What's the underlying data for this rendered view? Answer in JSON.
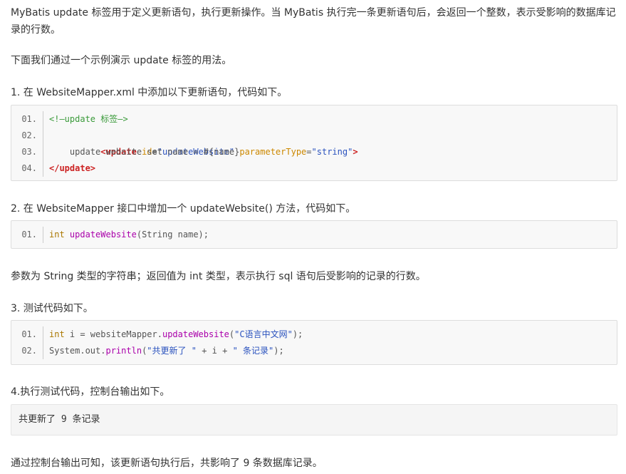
{
  "intro": {
    "para1": "MyBatis update 标签用于定义更新语句，执行更新操作。当 MyBatis 执行完一条更新语句后，会返回一个整数，表示受影响的数据库记录的行数。",
    "para2": "下面我们通过一个示例演示 update 标签的用法。"
  },
  "steps": [
    {
      "heading": "1. 在 WebsiteMapper.xml 中添加以下更新语句，代码如下。"
    },
    {
      "heading": "2. 在 WebsiteMapper 接口中增加一个 updateWebsite() 方法，代码如下。"
    },
    {
      "heading": "3. 测试代码如下。"
    },
    {
      "heading": "4.执行测试代码，控制台输出如下。"
    }
  ],
  "code_block_1": {
    "lines": [
      {
        "num": "01.",
        "comment": "<!—update 标签—>"
      },
      {
        "num": "02.",
        "tag_open": "<update",
        "attr1": "id",
        "eq1": "=",
        "val1": "\"updateWebsite\"",
        "attr2": "parameterType",
        "eq2": "=",
        "val2": "\"string\"",
        "tag_close": ">"
      },
      {
        "num": "03.",
        "text": "    update website set name = #{name}"
      },
      {
        "num": "04.",
        "tag_end": "</update>"
      }
    ]
  },
  "code_block_2": {
    "lines": [
      {
        "num": "01.",
        "kw": "int",
        "fn": "updateWebsite",
        "rest": "(String name);"
      }
    ]
  },
  "code_block_3": {
    "lines": [
      {
        "num": "01.",
        "kw": "int",
        "mid": " i = websiteMapper.",
        "fn": "updateWebsite",
        "open": "(",
        "str": "\"C语言中文网\"",
        "close": ");"
      },
      {
        "num": "02.",
        "pre": "System.out.",
        "fn": "println",
        "open": "(",
        "str1": "\"共更新了 \"",
        "mid": " + i + ",
        "str2": "\" 条记录\"",
        "close": ");"
      }
    ]
  },
  "params_note": "参数为 String 类型的字符串；返回值为 int 类型，表示执行 sql 语句后受影响的记录的行数。",
  "console_output": "共更新了 9 条记录",
  "conclusion": "通过控制台输出可知，该更新语句执行后，共影响了 9 条数据库记录。"
}
